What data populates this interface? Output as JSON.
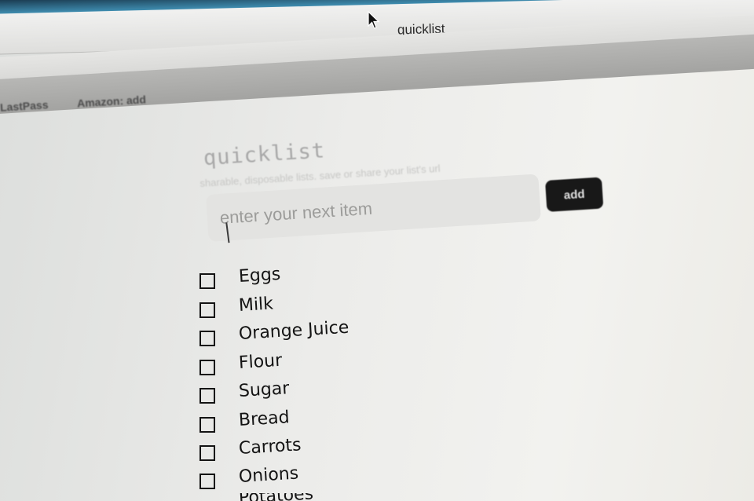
{
  "window": {
    "title": "quicklist"
  },
  "bookmarks_bar": {
    "items": [
      "LastPass",
      "Amazon: add"
    ]
  },
  "app": {
    "title": "quicklist",
    "subtitle": "sharable, disposable lists. save or share your list's url",
    "input": {
      "value": "",
      "placeholder": "enter your next item"
    },
    "add_label": "add"
  },
  "list": {
    "items": [
      {
        "label": "Eggs",
        "checked": false
      },
      {
        "label": "Milk",
        "checked": false
      },
      {
        "label": "Orange Juice",
        "checked": false
      },
      {
        "label": "Flour",
        "checked": false
      },
      {
        "label": "Sugar",
        "checked": false
      },
      {
        "label": "Bread",
        "checked": false
      },
      {
        "label": "Carrots",
        "checked": false
      },
      {
        "label": "Onions",
        "checked": false
      },
      {
        "label": "Potatoes",
        "checked": false
      }
    ]
  },
  "icons": {
    "cursor": "mouse-pointer-icon",
    "checkbox": "checkbox-empty-icon"
  },
  "colors": {
    "add_button_bg": "#181818",
    "title_gray": "#a8a8a8",
    "desktop_blue": "#3f8db0"
  }
}
